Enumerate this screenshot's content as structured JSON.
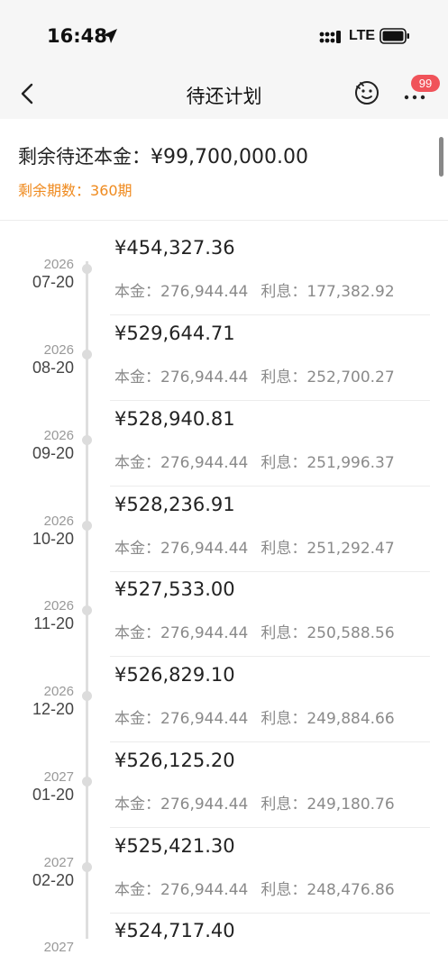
{
  "status_bar": {
    "time": "16:48",
    "network": "LTE"
  },
  "header": {
    "title": "待还计划",
    "badge": "99"
  },
  "summary": {
    "principal_label": "剩余待还本金：",
    "principal_value": "¥99,700,000.00",
    "periods_label": "剩余期数：",
    "periods_value": "360期"
  },
  "labels": {
    "principal": "本金：",
    "interest": "利息："
  },
  "schedule": [
    {
      "year": "2026",
      "date": "07-20",
      "amount": "¥454,327.36",
      "principal": "276,944.44",
      "interest": "177,382.92"
    },
    {
      "year": "2026",
      "date": "08-20",
      "amount": "¥529,644.71",
      "principal": "276,944.44",
      "interest": "252,700.27"
    },
    {
      "year": "2026",
      "date": "09-20",
      "amount": "¥528,940.81",
      "principal": "276,944.44",
      "interest": "251,996.37"
    },
    {
      "year": "2026",
      "date": "10-20",
      "amount": "¥528,236.91",
      "principal": "276,944.44",
      "interest": "251,292.47"
    },
    {
      "year": "2026",
      "date": "11-20",
      "amount": "¥527,533.00",
      "principal": "276,944.44",
      "interest": "250,588.56"
    },
    {
      "year": "2026",
      "date": "12-20",
      "amount": "¥526,829.10",
      "principal": "276,944.44",
      "interest": "249,884.66"
    },
    {
      "year": "2027",
      "date": "01-20",
      "amount": "¥526,125.20",
      "principal": "276,944.44",
      "interest": "249,180.76"
    },
    {
      "year": "2027",
      "date": "02-20",
      "amount": "¥525,421.30",
      "principal": "276,944.44",
      "interest": "248,476.86"
    },
    {
      "year": "2027",
      "date": "",
      "amount": "¥524,717.40",
      "principal": "",
      "interest": ""
    }
  ]
}
